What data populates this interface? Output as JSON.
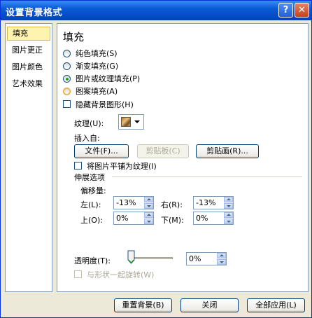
{
  "window": {
    "title": "设置背景格式",
    "help_glyph": "?",
    "close_glyph": "✕"
  },
  "sidebar": {
    "items": [
      {
        "label": "填充",
        "active": true
      },
      {
        "label": "图片更正",
        "active": false
      },
      {
        "label": "图片颜色",
        "active": false
      },
      {
        "label": "艺术效果",
        "active": false
      }
    ]
  },
  "fill": {
    "heading": "填充",
    "options": [
      {
        "label": "纯色填充(S)",
        "checked": false
      },
      {
        "label": "渐变填充(G)",
        "checked": false
      },
      {
        "label": "图片或纹理填充(P)",
        "checked": true
      },
      {
        "label": "图案填充(A)",
        "checked": false
      }
    ],
    "hide_background": {
      "label": "隐藏背景图形(H)",
      "checked": false
    },
    "texture_label": "纹理(U):",
    "insert_from": "插入自:",
    "file_button": "文件(F)...",
    "clipboard_button": "剪贴板(C)",
    "clipart_button": "剪贴画(R)...",
    "tile": {
      "label": "将图片平铺为纹理(I)",
      "checked": false
    },
    "stretch_heading": "伸展选项",
    "offset_label": "偏移量:",
    "left_label": "左(L):",
    "left_value": "-13%",
    "right_label": "右(R):",
    "right_value": "-13%",
    "top_label": "上(O):",
    "top_value": "0%",
    "bottom_label": "下(M):",
    "bottom_value": "0%",
    "transparency_label": "透明度(T):",
    "transparency_value": "0%",
    "transparency_level": 0,
    "rotate": {
      "label": "与形状一起旋转(W)",
      "checked": false,
      "disabled": true
    }
  },
  "footer": {
    "reset_button": "重置背景(B)",
    "close_button": "关闭",
    "apply_all_button": "全部应用(L)"
  },
  "colors": {
    "titlebar": "#0a5bd6",
    "dialog_bg": "#ece9d8",
    "active_item": "#fff3b0",
    "radio_checked": "#21a121"
  }
}
